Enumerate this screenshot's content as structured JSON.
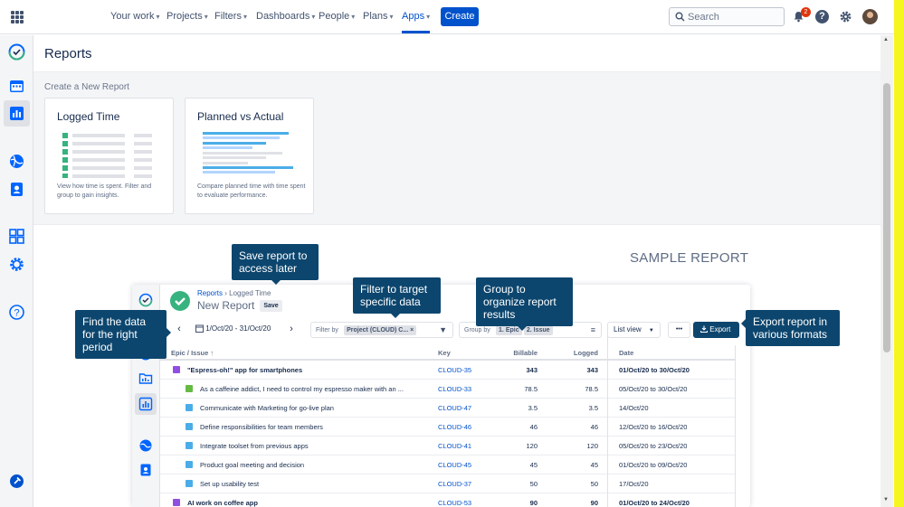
{
  "nav": {
    "items": [
      "Your work",
      "Projects",
      "Filters",
      "Dashboards",
      "People",
      "Plans",
      "Apps"
    ],
    "active": "Apps",
    "create_label": "Create",
    "search_placeholder": "Search",
    "notification_count": "2"
  },
  "page": {
    "title": "Reports",
    "create_new_label": "Create a New Report",
    "cards": [
      {
        "title": "Logged Time",
        "description": "View how time is spent. Filter and group to gain insights."
      },
      {
        "title": "Planned vs Actual",
        "description": "Compare planned time with time spent to evaluate performance."
      }
    ],
    "sample_label": "SAMPLE REPORT"
  },
  "sample": {
    "breadcrumb_link": "Reports",
    "breadcrumb_sep": "›",
    "breadcrumb_current": "Logged Time",
    "report_title": "New Report",
    "save_label": "Save",
    "date_range": "1/Oct/20 - 31/Oct/20",
    "filter_label": "Filter by",
    "filter_chip": "Project (CLOUD) C...",
    "group_label": "Group by",
    "group_chips": [
      "1. Epic",
      "2. Issue"
    ],
    "view_label": "List view",
    "more_label": "•••",
    "export_label": "Export",
    "columns": [
      "Epic / Issue",
      "Key",
      "Billable",
      "Logged",
      "Date"
    ],
    "rows": [
      {
        "type": "epic",
        "summary": "\"Espress-oh!\" app for smartphones",
        "key": "CLOUD-35",
        "billable": "343",
        "logged": "343",
        "date": "01/Oct/20 to 30/Oct/20"
      },
      {
        "type": "story",
        "summary": "As a caffeine addict, I need to control my espresso maker with an ...",
        "key": "CLOUD-33",
        "billable": "78.5",
        "logged": "78.5",
        "date": "05/Oct/20 to 30/Oct/20"
      },
      {
        "type": "task",
        "summary": "Communicate with Marketing for go-live plan",
        "key": "CLOUD-47",
        "billable": "3.5",
        "logged": "3.5",
        "date": "14/Oct/20"
      },
      {
        "type": "task",
        "summary": "Define responsibilities for team members",
        "key": "CLOUD-46",
        "billable": "46",
        "logged": "46",
        "date": "12/Oct/20 to 16/Oct/20"
      },
      {
        "type": "task",
        "summary": "Integrate toolset from previous apps",
        "key": "CLOUD-41",
        "billable": "120",
        "logged": "120",
        "date": "05/Oct/20 to 23/Oct/20"
      },
      {
        "type": "task",
        "summary": "Product goal meeting and decision",
        "key": "CLOUD-45",
        "billable": "45",
        "logged": "45",
        "date": "01/Oct/20 to 09/Oct/20"
      },
      {
        "type": "task",
        "summary": "Set up usability test",
        "key": "CLOUD-37",
        "billable": "50",
        "logged": "50",
        "date": "17/Oct/20"
      },
      {
        "type": "epic",
        "summary": "AI work on coffee app",
        "key": "CLOUD-53",
        "billable": "90",
        "logged": "90",
        "date": "01/Oct/20 to 24/Oct/20"
      }
    ]
  },
  "callouts": {
    "save": "Save report to access later",
    "filter": "Filter to target specific data",
    "group": "Group to organize report results",
    "find": "Find the data for the right period",
    "export": "Export report in various formats"
  },
  "colors": {
    "accent": "#0052cc",
    "callout": "#0c466e",
    "success": "#36b37e",
    "highlight": "#f5f520"
  }
}
